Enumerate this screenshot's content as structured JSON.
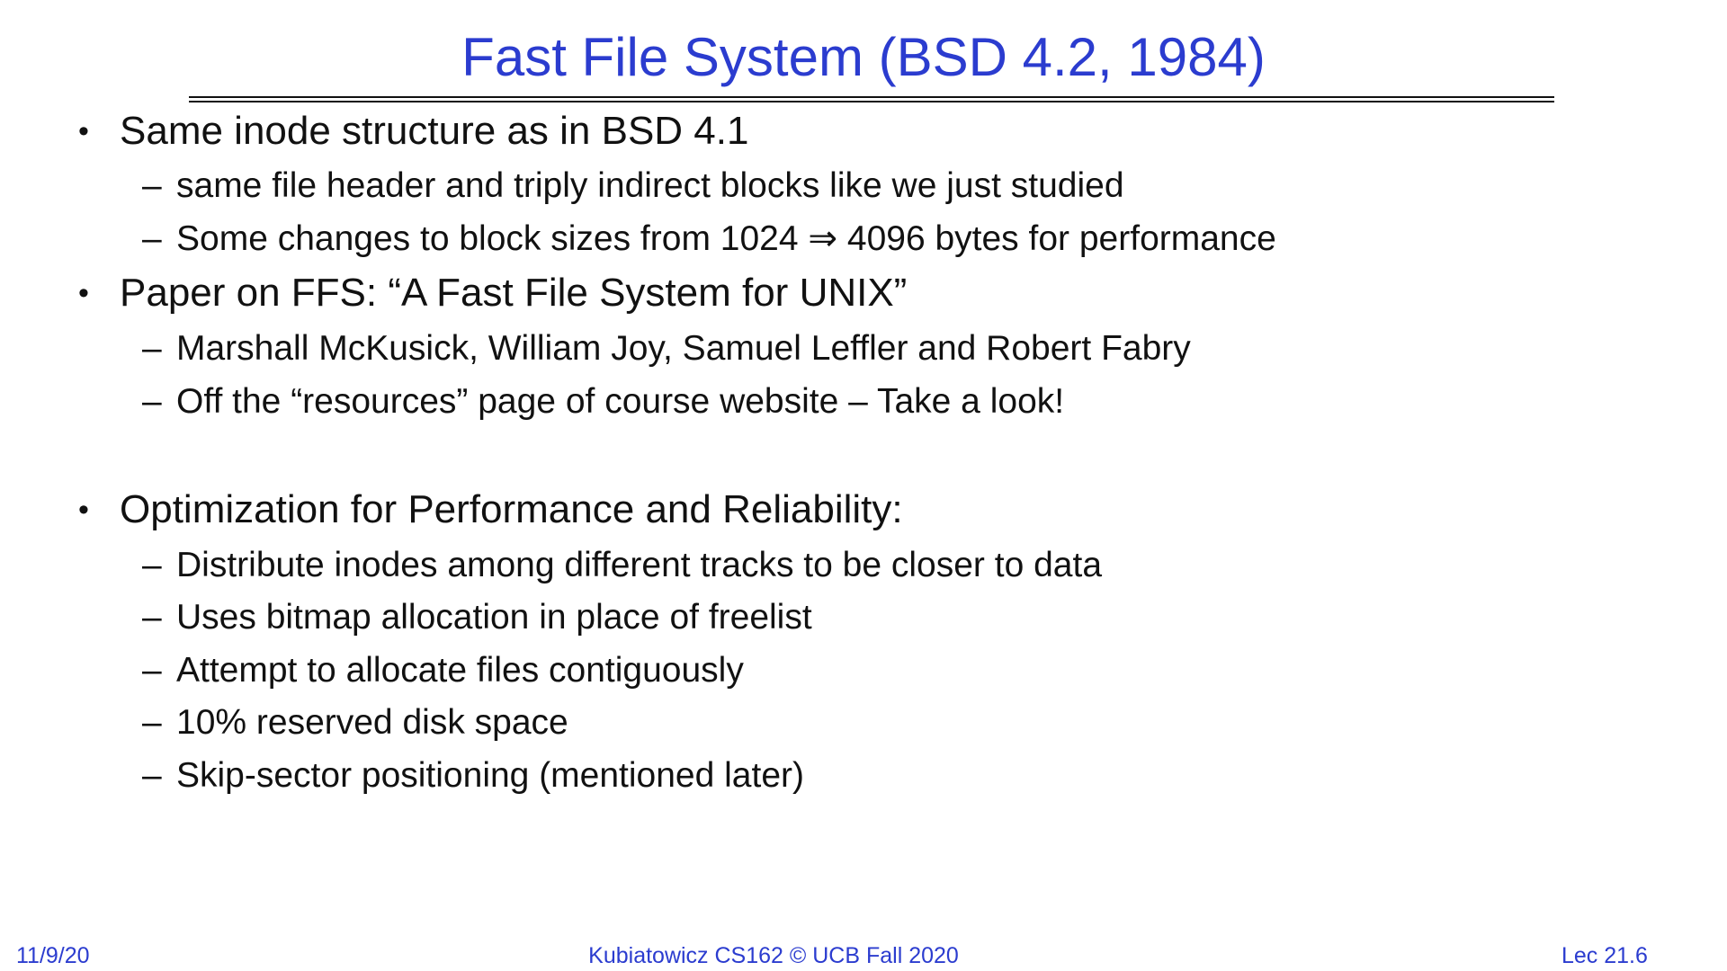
{
  "title": "Fast File System (BSD 4.2, 1984)",
  "bullet_symbol": "•",
  "dash_symbol": "–",
  "bullets": [
    {
      "text": "Same inode structure as in BSD 4.1",
      "subs": [
        "same file header and triply indirect blocks like we just studied",
        "Some changes to block sizes from 1024 ⇒ 4096 bytes for performance"
      ]
    },
    {
      "text": "Paper on FFS: “A Fast File System for UNIX”",
      "subs": [
        "Marshall McKusick, William Joy, Samuel Leffler and Robert Fabry",
        "Off the “resources” page of course website – Take a look!"
      ]
    },
    {
      "text": "Optimization for Performance and Reliability:",
      "subs": [
        "Distribute inodes among different tracks to be closer to data",
        "Uses bitmap allocation in place of freelist",
        "Attempt to allocate files contiguously",
        "10% reserved disk space",
        "Skip-sector positioning (mentioned later)"
      ]
    }
  ],
  "footer": {
    "date": "11/9/20",
    "course": "Kubiatowicz CS162 © UCB Fall 2020",
    "lecture": "Lec 21.6"
  },
  "colors": {
    "title": "#2b3ccf",
    "text": "#111111"
  }
}
